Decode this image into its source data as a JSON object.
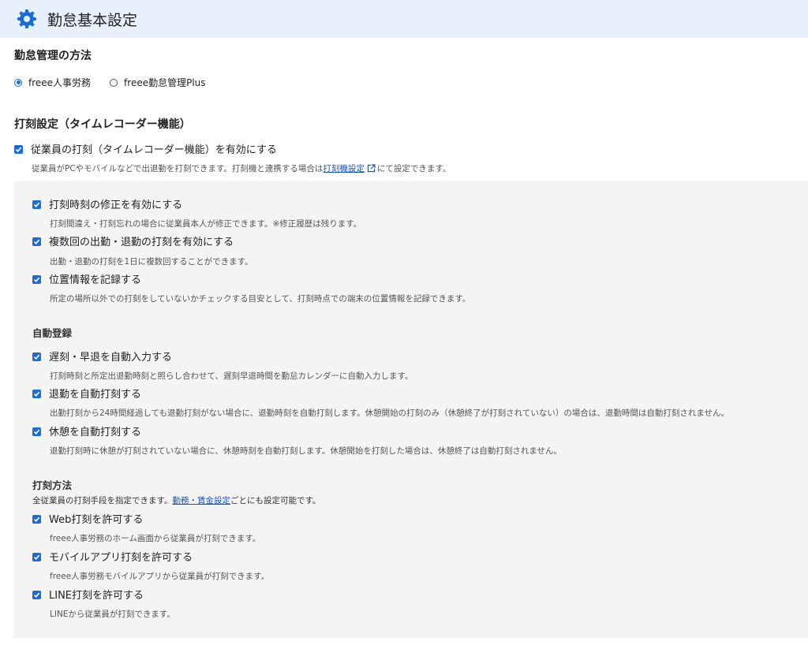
{
  "header": {
    "title": "勤怠基本設定",
    "icon": "gear-icon",
    "accent": "#1a6cd7"
  },
  "attendance_method": {
    "title": "勤怠管理の方法",
    "options": [
      {
        "label": "freee人事労務",
        "selected": true
      },
      {
        "label": "freee勤怠管理Plus",
        "selected": false
      }
    ]
  },
  "punch_settings": {
    "title": "打刻設定（タイムレコーダー機能）",
    "enable": {
      "label": "従業員の打刻（タイムレコーダー機能）を有効にする",
      "checked": true,
      "desc_before": "従業員がPCやモバイルなどで出退勤を打刻できます。打刻機と連携する場合は",
      "desc_link": "打刻機設定",
      "desc_after": "にて設定できます。"
    },
    "options": [
      {
        "label": "打刻時刻の修正を有効にする",
        "desc": "打刻間違え・打刻忘れの場合に従業員本人が修正できます。※修正履歴は残ります。",
        "checked": true
      },
      {
        "label": "複数回の出勤・退勤の打刻を有効にする",
        "desc": "出勤・退勤の打刻を1日に複数回することができます。",
        "checked": true
      },
      {
        "label": "位置情報を記録する",
        "desc": "所定の場所以外での打刻をしていないかチェックする目安として、打刻時点での端末の位置情報を記録できます。",
        "checked": true
      }
    ],
    "auto": {
      "title": "自動登録",
      "items": [
        {
          "label": "遅刻・早退を自動入力する",
          "desc": "打刻時刻と所定出退勤時刻と照らし合わせて、遅刻早退時間を勤怠カレンダーに自動入力します。",
          "checked": true
        },
        {
          "label": "退勤を自動打刻する",
          "desc": "出勤打刻から24時間経過しても退勤打刻がない場合に、退勤時刻を自動打刻します。休憩開始の打刻のみ（休憩終了が打刻されていない）の場合は、退勤時間は自動打刻されません。",
          "checked": true
        },
        {
          "label": "休憩を自動打刻する",
          "desc": "退勤打刻時に休憩が打刻されていない場合に、休憩時刻を自動打刻します。休憩開始を打刻した場合は、休憩終了は自動打刻されません。",
          "checked": true
        }
      ]
    },
    "methods": {
      "title": "打刻方法",
      "desc_before": "全従業員の打刻手段を指定できます。",
      "desc_link": "勤務・賃金設定",
      "desc_after": "ごとにも設定可能です。",
      "items": [
        {
          "label": "Web打刻を許可する",
          "desc": "freee人事労務のホーム画面から従業員が打刻できます。",
          "checked": true
        },
        {
          "label": "モバイルアプリ打刻を許可する",
          "desc": "freee人事労務モバイルアプリから従業員が打刻できます。",
          "checked": true
        },
        {
          "label": "LINE打刻を許可する",
          "desc": "LINEから従業員が打刻できます。",
          "checked": true
        }
      ]
    }
  }
}
